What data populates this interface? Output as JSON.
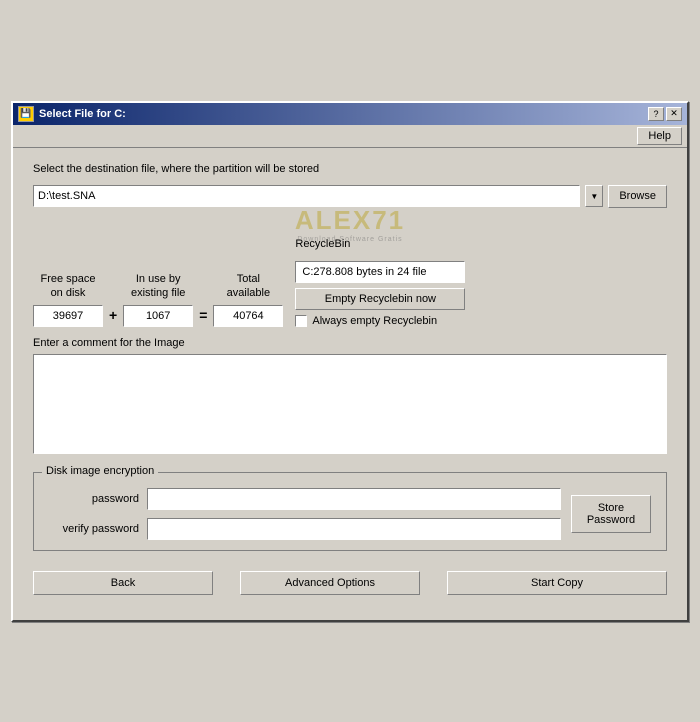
{
  "window": {
    "title": "Select File for C:",
    "help_button": "Help"
  },
  "description": "Select the destination file, where the partition will be stored",
  "file_path": {
    "value": "D:\\test.SNA",
    "browse_label": "Browse"
  },
  "disk_info": {
    "free_space_label": "Free space\non disk",
    "in_use_label": "In use by\nexisting file",
    "total_label": "Total\navailable",
    "recyclebin_label": "RecycleBin",
    "free_space_value": "39697",
    "in_use_value": "1067",
    "total_value": "40764",
    "recyclebin_value": "C:278.808 bytes in 24 file",
    "operator_plus": "+",
    "operator_equals": "=",
    "empty_recyclebin_label": "Empty Recyclebin now",
    "always_empty_label": "Always empty Recyclebin"
  },
  "comment": {
    "label": "Enter a comment for the Image"
  },
  "encryption": {
    "group_label": "Disk image encryption",
    "password_label": "password",
    "verify_label": "verify password",
    "store_btn": "Store\nPassword"
  },
  "buttons": {
    "back": "Back",
    "advanced": "Advanced Options",
    "start_copy": "Start Copy"
  },
  "watermark": {
    "main": "ALEX71",
    "sub": "Download Software Gratis"
  }
}
